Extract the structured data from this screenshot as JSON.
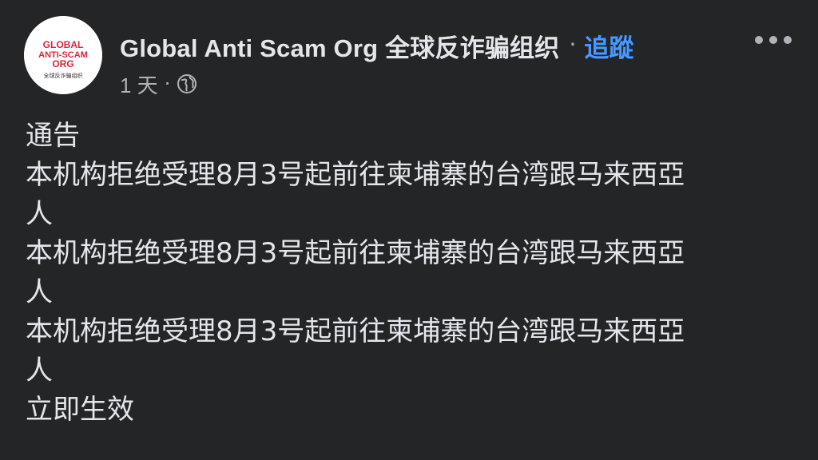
{
  "post": {
    "author": "Global Anti Scam Org  全球反诈骗组织",
    "separator": "·",
    "follow_label": "追蹤",
    "timestamp": "1 天",
    "meta_separator": "·",
    "avatar": {
      "logo_line1": "GLOBAL",
      "logo_line2": "ANTI-SCAM",
      "logo_line3": "ORG",
      "logo_subtitle": "全球反诈骗组织"
    },
    "icons": {
      "more": "more-horizontal-icon",
      "privacy": "globe-icon"
    },
    "body_lines": [
      "通告",
      "本机构拒绝受理8月3号起前往柬埔寨的台湾跟马来西亞",
      "人",
      "本机构拒绝受理8月3号起前往柬埔寨的台湾跟马来西亞",
      "人",
      "本机构拒绝受理8月3号起前往柬埔寨的台湾跟马来西亞",
      "人",
      "立即生效"
    ]
  },
  "colors": {
    "background": "#242526",
    "primary_text": "#e4e6eb",
    "secondary_text": "#b0b3b8",
    "link": "#4599ff",
    "logo_red": "#d7263d"
  }
}
